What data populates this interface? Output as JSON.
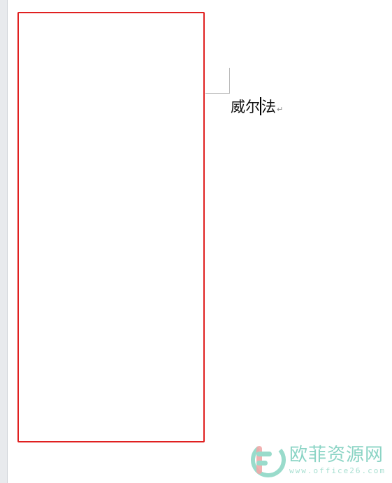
{
  "document": {
    "text_before_caret": "威尔",
    "text_after_caret": "法",
    "paragraph_mark": "↵"
  },
  "watermark": {
    "brand": "欧菲资源网",
    "url": "www.office26.com"
  },
  "colors": {
    "outline": "#e02020",
    "watermark_primary": "#7fd0bf",
    "watermark_secondary": "#f2a6a6"
  },
  "icons": {
    "watermark_logo": "office26-logo-icon"
  }
}
